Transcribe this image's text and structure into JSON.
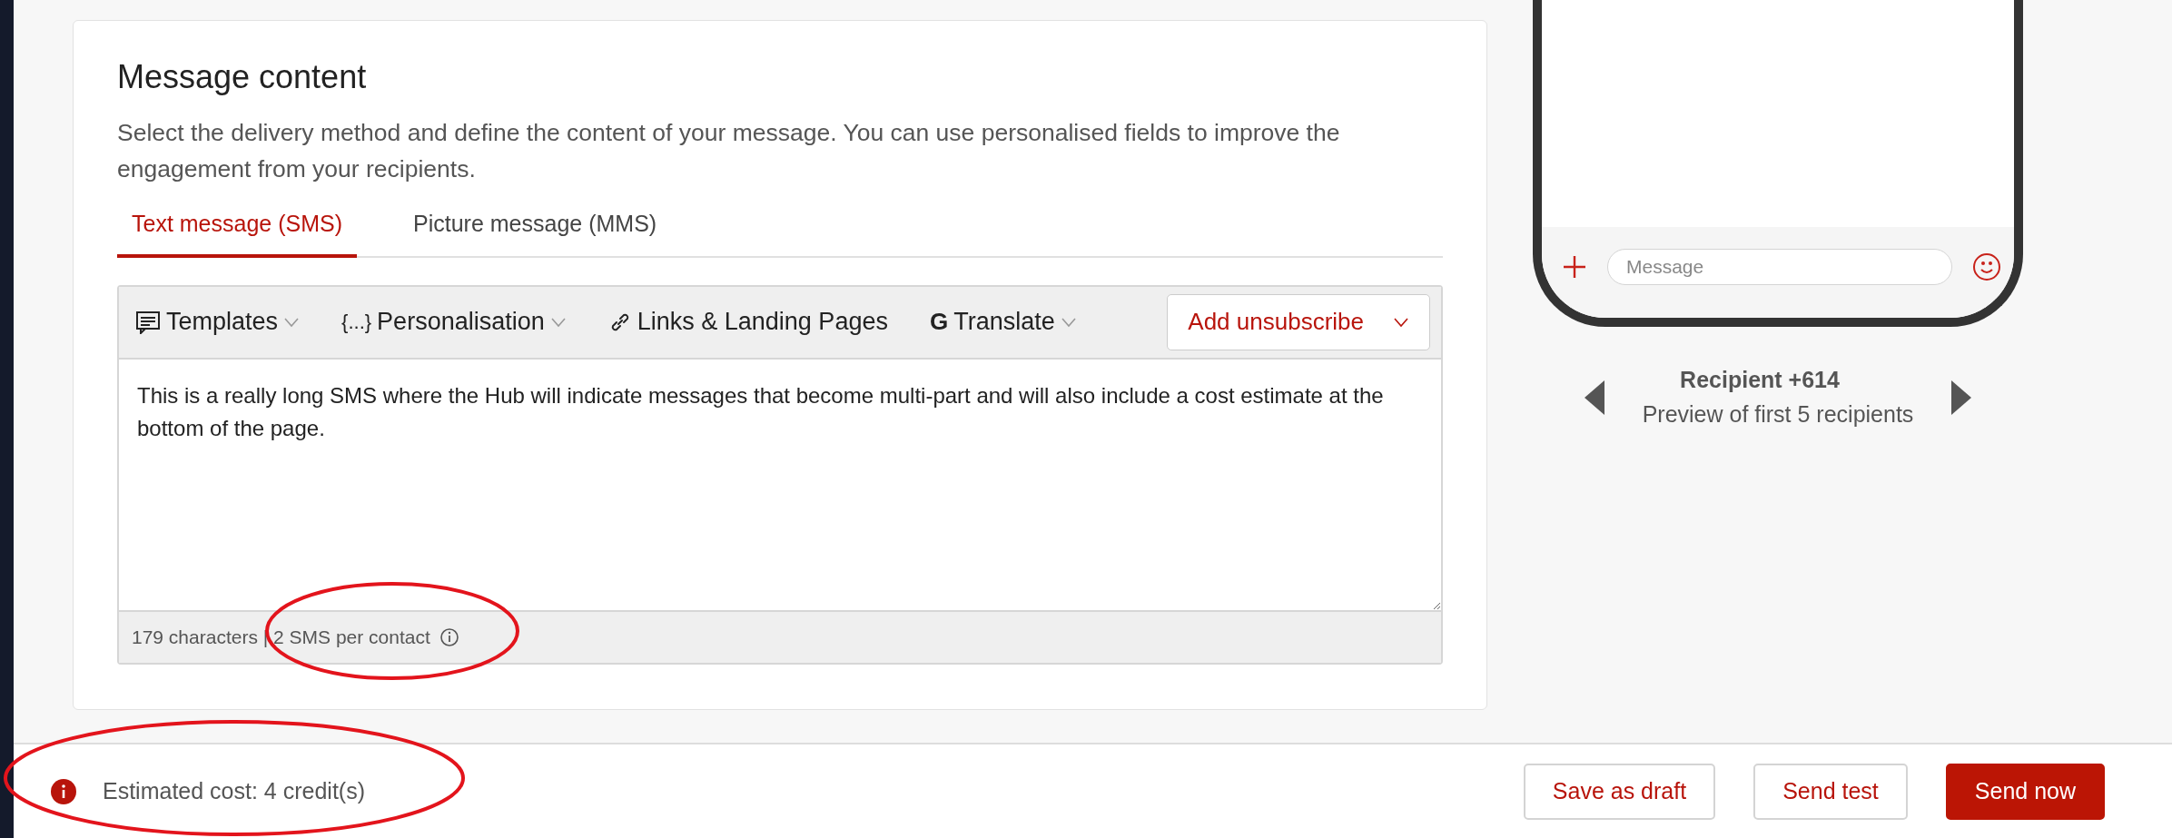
{
  "card": {
    "title": "Message content",
    "description": "Select the delivery method and define the content of your message. You can use personalised fields to improve the engagement from your recipients.",
    "tabs": [
      {
        "label": "Text message (SMS)",
        "selected": true
      },
      {
        "label": "Picture message (MMS)",
        "selected": false
      }
    ],
    "toolbar": [
      {
        "kind": "templates",
        "label": "Templates",
        "dropdown": true
      },
      {
        "kind": "personalisation",
        "glyph": "{...}",
        "label": "Personalisation",
        "dropdown": true
      },
      {
        "kind": "links",
        "label": "Links & Landing Pages",
        "dropdown": false
      },
      {
        "kind": "translate",
        "glyph": "G",
        "label": "Translate",
        "dropdown": true
      }
    ],
    "unsubscribe_button": {
      "label": "Add unsubscribe"
    },
    "message_text": "This is a really long SMS where the Hub will indicate messages that become multi-part and will also include a cost estimate at the bottom of the page.",
    "counter": "179 characters | 2 SMS per contact"
  },
  "preview": {
    "input_placeholder": "Message",
    "recipient": "Recipient +614",
    "note": "Preview of first 5 recipients"
  },
  "footer": {
    "estimate": "Estimated cost: 4 credit(s)",
    "buttons": [
      {
        "label": "Save as draft",
        "primary": false
      },
      {
        "label": "Send test",
        "primary": false
      },
      {
        "label": "Send now",
        "primary": true
      }
    ]
  }
}
